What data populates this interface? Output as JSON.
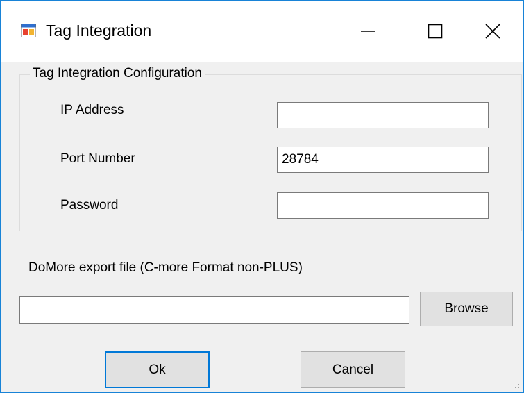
{
  "window": {
    "title": "Tag Integration",
    "app_icon": "form-window-icon",
    "controls": {
      "minimize_icon": "minimize-icon",
      "maximize_icon": "maximize-icon",
      "close_icon": "close-icon"
    }
  },
  "config_group": {
    "legend": "Tag Integration Configuration",
    "fields": {
      "ip": {
        "label": "IP Address",
        "value": ""
      },
      "port": {
        "label": "Port Number",
        "value": "28784"
      },
      "password": {
        "label": "Password",
        "value": ""
      }
    }
  },
  "export": {
    "label": "DoMore export file (C-more Format non-PLUS)",
    "file_value": "",
    "browse_label": "Browse"
  },
  "footer": {
    "ok_label": "Ok",
    "cancel_label": "Cancel"
  },
  "colors": {
    "window_border": "#1883d7",
    "accent_focus": "#0078d7",
    "dialog_bg": "#f0f0f0",
    "button_bg": "#e1e1e1"
  }
}
